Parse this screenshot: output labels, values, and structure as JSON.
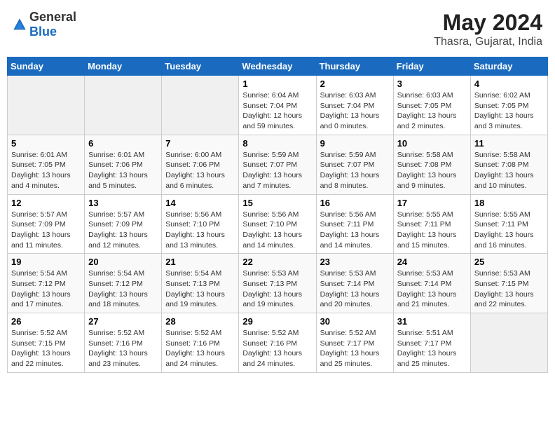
{
  "header": {
    "logo_general": "General",
    "logo_blue": "Blue",
    "title": "May 2024",
    "subtitle": "Thasra, Gujarat, India"
  },
  "days_of_week": [
    "Sunday",
    "Monday",
    "Tuesday",
    "Wednesday",
    "Thursday",
    "Friday",
    "Saturday"
  ],
  "weeks": [
    [
      {
        "day": "",
        "content": ""
      },
      {
        "day": "",
        "content": ""
      },
      {
        "day": "",
        "content": ""
      },
      {
        "day": "1",
        "content": "Sunrise: 6:04 AM\nSunset: 7:04 PM\nDaylight: 12 hours\nand 59 minutes."
      },
      {
        "day": "2",
        "content": "Sunrise: 6:03 AM\nSunset: 7:04 PM\nDaylight: 13 hours\nand 0 minutes."
      },
      {
        "day": "3",
        "content": "Sunrise: 6:03 AM\nSunset: 7:05 PM\nDaylight: 13 hours\nand 2 minutes."
      },
      {
        "day": "4",
        "content": "Sunrise: 6:02 AM\nSunset: 7:05 PM\nDaylight: 13 hours\nand 3 minutes."
      }
    ],
    [
      {
        "day": "5",
        "content": "Sunrise: 6:01 AM\nSunset: 7:05 PM\nDaylight: 13 hours\nand 4 minutes."
      },
      {
        "day": "6",
        "content": "Sunrise: 6:01 AM\nSunset: 7:06 PM\nDaylight: 13 hours\nand 5 minutes."
      },
      {
        "day": "7",
        "content": "Sunrise: 6:00 AM\nSunset: 7:06 PM\nDaylight: 13 hours\nand 6 minutes."
      },
      {
        "day": "8",
        "content": "Sunrise: 5:59 AM\nSunset: 7:07 PM\nDaylight: 13 hours\nand 7 minutes."
      },
      {
        "day": "9",
        "content": "Sunrise: 5:59 AM\nSunset: 7:07 PM\nDaylight: 13 hours\nand 8 minutes."
      },
      {
        "day": "10",
        "content": "Sunrise: 5:58 AM\nSunset: 7:08 PM\nDaylight: 13 hours\nand 9 minutes."
      },
      {
        "day": "11",
        "content": "Sunrise: 5:58 AM\nSunset: 7:08 PM\nDaylight: 13 hours\nand 10 minutes."
      }
    ],
    [
      {
        "day": "12",
        "content": "Sunrise: 5:57 AM\nSunset: 7:09 PM\nDaylight: 13 hours\nand 11 minutes."
      },
      {
        "day": "13",
        "content": "Sunrise: 5:57 AM\nSunset: 7:09 PM\nDaylight: 13 hours\nand 12 minutes."
      },
      {
        "day": "14",
        "content": "Sunrise: 5:56 AM\nSunset: 7:10 PM\nDaylight: 13 hours\nand 13 minutes."
      },
      {
        "day": "15",
        "content": "Sunrise: 5:56 AM\nSunset: 7:10 PM\nDaylight: 13 hours\nand 14 minutes."
      },
      {
        "day": "16",
        "content": "Sunrise: 5:56 AM\nSunset: 7:11 PM\nDaylight: 13 hours\nand 14 minutes."
      },
      {
        "day": "17",
        "content": "Sunrise: 5:55 AM\nSunset: 7:11 PM\nDaylight: 13 hours\nand 15 minutes."
      },
      {
        "day": "18",
        "content": "Sunrise: 5:55 AM\nSunset: 7:11 PM\nDaylight: 13 hours\nand 16 minutes."
      }
    ],
    [
      {
        "day": "19",
        "content": "Sunrise: 5:54 AM\nSunset: 7:12 PM\nDaylight: 13 hours\nand 17 minutes."
      },
      {
        "day": "20",
        "content": "Sunrise: 5:54 AM\nSunset: 7:12 PM\nDaylight: 13 hours\nand 18 minutes."
      },
      {
        "day": "21",
        "content": "Sunrise: 5:54 AM\nSunset: 7:13 PM\nDaylight: 13 hours\nand 19 minutes."
      },
      {
        "day": "22",
        "content": "Sunrise: 5:53 AM\nSunset: 7:13 PM\nDaylight: 13 hours\nand 19 minutes."
      },
      {
        "day": "23",
        "content": "Sunrise: 5:53 AM\nSunset: 7:14 PM\nDaylight: 13 hours\nand 20 minutes."
      },
      {
        "day": "24",
        "content": "Sunrise: 5:53 AM\nSunset: 7:14 PM\nDaylight: 13 hours\nand 21 minutes."
      },
      {
        "day": "25",
        "content": "Sunrise: 5:53 AM\nSunset: 7:15 PM\nDaylight: 13 hours\nand 22 minutes."
      }
    ],
    [
      {
        "day": "26",
        "content": "Sunrise: 5:52 AM\nSunset: 7:15 PM\nDaylight: 13 hours\nand 22 minutes."
      },
      {
        "day": "27",
        "content": "Sunrise: 5:52 AM\nSunset: 7:16 PM\nDaylight: 13 hours\nand 23 minutes."
      },
      {
        "day": "28",
        "content": "Sunrise: 5:52 AM\nSunset: 7:16 PM\nDaylight: 13 hours\nand 24 minutes."
      },
      {
        "day": "29",
        "content": "Sunrise: 5:52 AM\nSunset: 7:16 PM\nDaylight: 13 hours\nand 24 minutes."
      },
      {
        "day": "30",
        "content": "Sunrise: 5:52 AM\nSunset: 7:17 PM\nDaylight: 13 hours\nand 25 minutes."
      },
      {
        "day": "31",
        "content": "Sunrise: 5:51 AM\nSunset: 7:17 PM\nDaylight: 13 hours\nand 25 minutes."
      },
      {
        "day": "",
        "content": ""
      }
    ]
  ]
}
